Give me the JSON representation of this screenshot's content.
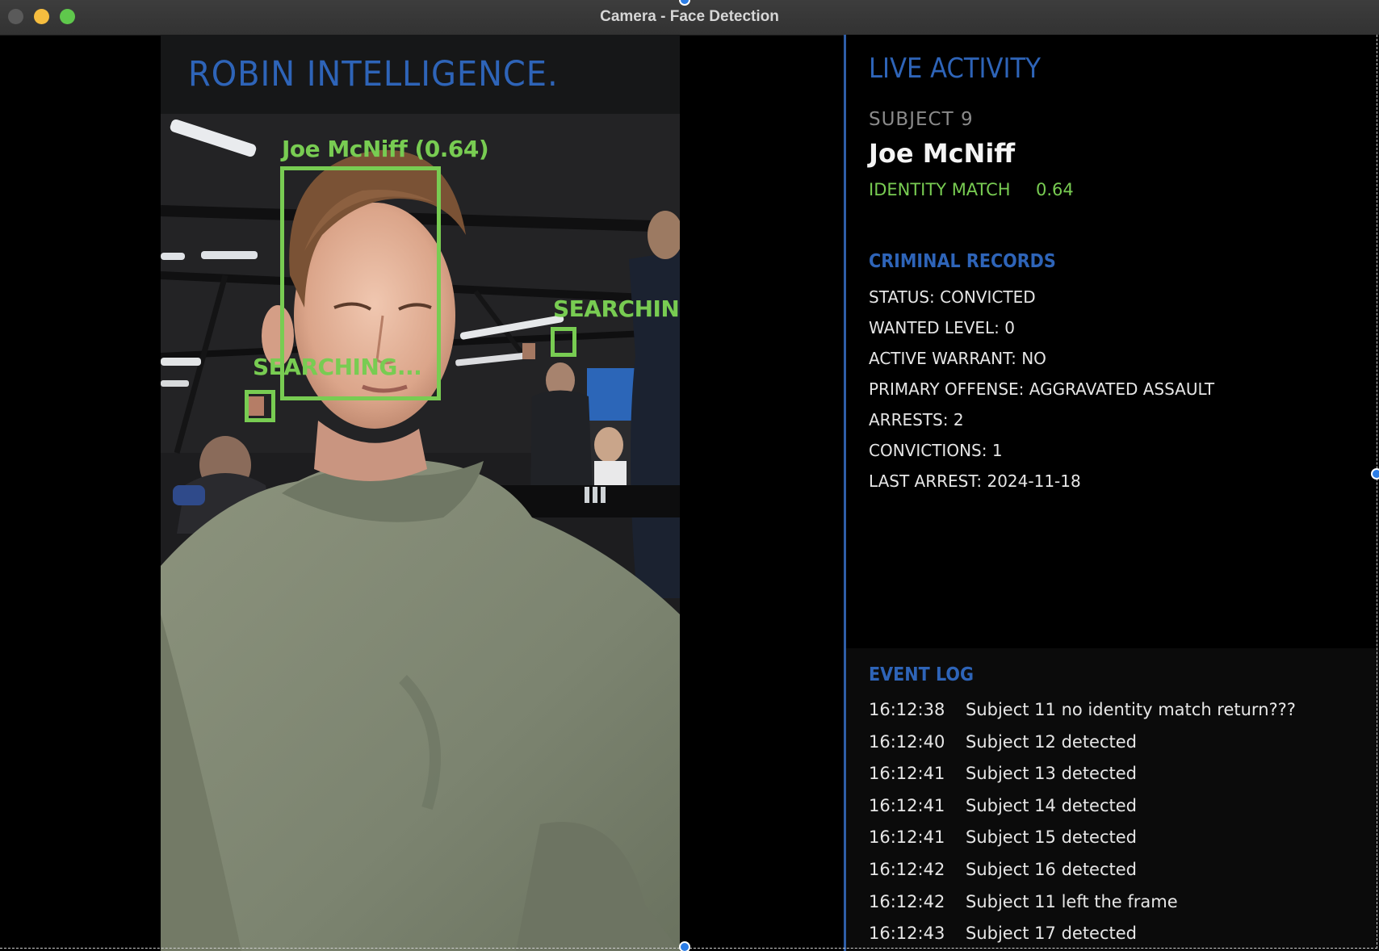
{
  "window": {
    "title": "Camera - Face Detection"
  },
  "camera": {
    "brand": "ROBIN INTELLIGENCE.",
    "detections": [
      {
        "label": "Joe McNiff (0.64)"
      },
      {
        "label": "SEARCHING..."
      },
      {
        "label": "SEARCHING"
      }
    ],
    "colors": {
      "box": "#78cc52",
      "brand": "#2e64b8"
    }
  },
  "live": {
    "heading": "LIVE ACTIVITY",
    "subject_label": "SUBJECT 9",
    "subject_name": "Joe McNiff",
    "match_label": "IDENTITY MATCH",
    "match_score": "0.64"
  },
  "records": {
    "heading": "CRIMINAL RECORDS",
    "items": [
      "STATUS: CONVICTED",
      "WANTED LEVEL: 0",
      "ACTIVE WARRANT: NO",
      "PRIMARY OFFENSE: AGGRAVATED ASSAULT",
      "ARRESTS: 2",
      "CONVICTIONS: 1",
      "LAST ARREST: 2024-11-18"
    ]
  },
  "events": {
    "heading": "EVENT LOG",
    "items": [
      {
        "time": "16:12:38",
        "text": "Subject 11 no identity match return???"
      },
      {
        "time": "16:12:40",
        "text": "Subject 12 detected"
      },
      {
        "time": "16:12:41",
        "text": "Subject 13 detected"
      },
      {
        "time": "16:12:41",
        "text": "Subject 14 detected"
      },
      {
        "time": "16:12:41",
        "text": "Subject 15 detected"
      },
      {
        "time": "16:12:42",
        "text": "Subject 16 detected"
      },
      {
        "time": "16:12:42",
        "text": "Subject 11 left the frame"
      },
      {
        "time": "16:12:43",
        "text": "Subject 17 detected"
      }
    ]
  }
}
